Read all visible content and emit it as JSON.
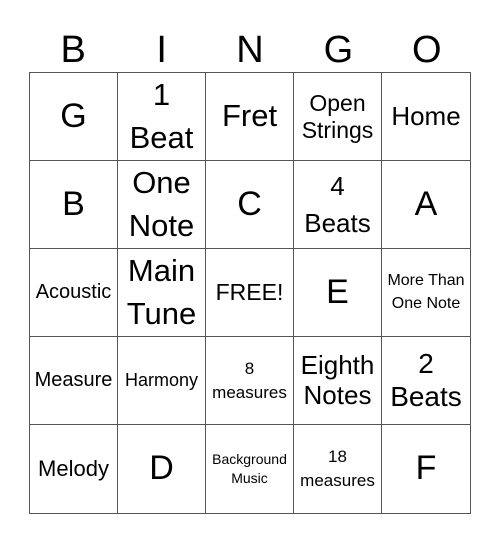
{
  "header": [
    "B",
    "I",
    "N",
    "G",
    "O"
  ],
  "cells": [
    "G",
    "1 Beat",
    "Fret",
    "Open Strings",
    "Home",
    "B",
    "One Note",
    "C",
    "4 Beats",
    "A",
    "Acoustic",
    "Main Tune",
    "FREE!",
    "E",
    "More Than One Note",
    "Measure",
    "Harmony",
    "8 measures",
    "Eighth Notes",
    "2 Beats",
    "Melody",
    "D",
    "Background Music",
    "18 measures",
    "F"
  ]
}
